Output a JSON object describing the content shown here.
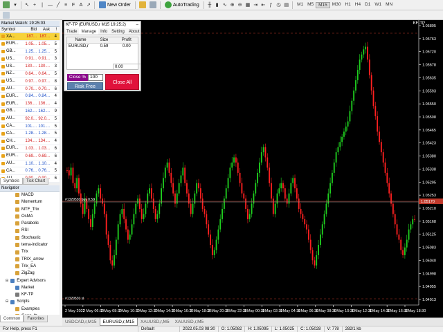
{
  "toolbar": {
    "new_order": "New Order",
    "auto_trading": "AutoTrading",
    "timeframes": [
      "M1",
      "M5",
      "M15",
      "M30",
      "H1",
      "H4",
      "D1",
      "W1",
      "MN"
    ],
    "active_timeframe": "M15"
  },
  "market_watch": {
    "title": "Market Watch: 19:25:03",
    "columns": [
      "Symbol",
      "Bid",
      "Ask",
      "!"
    ],
    "rows": [
      {
        "sym": "XA...",
        "bid": "187...",
        "ask": "187...",
        "sp": "4",
        "dir": "dn",
        "sel": true
      },
      {
        "sym": "EUR...",
        "bid": "1.05...",
        "ask": "1.05...",
        "sp": "5",
        "dir": "dn"
      },
      {
        "sym": "GB...",
        "bid": "1.25...",
        "ask": "1.25...",
        "sp": "5",
        "dir": "up"
      },
      {
        "sym": "US...",
        "bid": "0.91...",
        "ask": "0.91...",
        "sp": "3",
        "dir": "dn"
      },
      {
        "sym": "US...",
        "bid": "130....",
        "ask": "130....",
        "sp": "3",
        "dir": "dn"
      },
      {
        "sym": "NZ...",
        "bid": "0.64...",
        "ask": "0.64...",
        "sp": "5",
        "dir": "dn"
      },
      {
        "sym": "US...",
        "bid": "0.97...",
        "ask": "0.97...",
        "sp": "8",
        "dir": "dn"
      },
      {
        "sym": "AU...",
        "bid": "0.70...",
        "ask": "0.70...",
        "sp": "6",
        "dir": "dn"
      },
      {
        "sym": "EUR...",
        "bid": "0.84...",
        "ask": "0.84...",
        "sp": "4",
        "dir": "up"
      },
      {
        "sym": "EUR...",
        "bid": "136....",
        "ask": "136....",
        "sp": "4",
        "dir": "dn"
      },
      {
        "sym": "GB...",
        "bid": "162....",
        "ask": "162....",
        "sp": "9",
        "dir": "up"
      },
      {
        "sym": "AU...",
        "bid": "92.0...",
        "ask": "92.0...",
        "sp": "5",
        "dir": "dn"
      },
      {
        "sym": "CA...",
        "bid": "101....",
        "ask": "101....",
        "sp": "5",
        "dir": "up"
      },
      {
        "sym": "CA...",
        "bid": "1.28...",
        "ask": "1.28...",
        "sp": "5",
        "dir": "up"
      },
      {
        "sym": "CH...",
        "bid": "134....",
        "ask": "134....",
        "sp": "4",
        "dir": "dn"
      },
      {
        "sym": "EUR...",
        "bid": "1.03...",
        "ask": "1.03...",
        "sp": "6",
        "dir": "dn"
      },
      {
        "sym": "EUR...",
        "bid": "0.69...",
        "ask": "0.69...",
        "sp": "6",
        "dir": "dn"
      },
      {
        "sym": "AU...",
        "bid": "1.10...",
        "ask": "1.10...",
        "sp": "4",
        "dir": "up"
      },
      {
        "sym": "CA...",
        "bid": "0.76...",
        "ask": "0.76...",
        "sp": "5",
        "dir": "up"
      },
      {
        "sym": "AU...",
        "bid": "0.90...",
        "ask": "0.90...",
        "sp": "6",
        "dir": "dn"
      }
    ],
    "tabs": [
      "Symbols",
      "Tick Chart"
    ]
  },
  "navigator": {
    "title": "Navigator",
    "items": [
      {
        "label": "MACD",
        "indent": 2,
        "color": "#d8a23a"
      },
      {
        "label": "Momentum",
        "indent": 2,
        "color": "#d8a23a"
      },
      {
        "label": "MTF_Trix",
        "indent": 2,
        "color": "#d8a23a"
      },
      {
        "label": "OsMA",
        "indent": 2,
        "color": "#d8a23a"
      },
      {
        "label": "Parabolic",
        "indent": 2,
        "color": "#d8a23a"
      },
      {
        "label": "RSI",
        "indent": 2,
        "color": "#d8a23a"
      },
      {
        "label": "Stochastic",
        "indent": 2,
        "color": "#d8a23a"
      },
      {
        "label": "tema-indicator",
        "indent": 2,
        "color": "#d8a23a"
      },
      {
        "label": "Trix",
        "indent": 2,
        "color": "#d8a23a"
      },
      {
        "label": "TRIX_arrow",
        "indent": 2,
        "color": "#d8a23a"
      },
      {
        "label": "Trix_EA",
        "indent": 2,
        "color": "#d8a23a"
      },
      {
        "label": "ZigZag",
        "indent": 2,
        "color": "#d8a23a"
      },
      {
        "label": "Expert Advisors",
        "indent": 1,
        "color": "#4a7fc0"
      },
      {
        "label": "Market",
        "indent": 2,
        "color": "#4a7fc0"
      },
      {
        "label": "KF-TP",
        "indent": 2,
        "color": "#7a7a7a"
      },
      {
        "label": "Scripts",
        "indent": 1,
        "color": "#4a7fc0"
      },
      {
        "label": "Examples",
        "indent": 2,
        "color": "#d8a23a"
      },
      {
        "label": "Gann_fz",
        "indent": 2,
        "color": "#d8a23a"
      },
      {
        "label": "PeriodConverter",
        "indent": 2,
        "color": "#d8a23a"
      }
    ],
    "tabs": [
      "Common",
      "Favorites"
    ]
  },
  "chart": {
    "label": "KF-TP",
    "price_labels": [
      "1.05805",
      "1.05763",
      "1.05720",
      "1.05678",
      "1.05635",
      "1.05593",
      "1.05550",
      "1.05508",
      "1.05465",
      "1.05423",
      "1.05380",
      "1.05338",
      "1.05295",
      "1.05253",
      "1.05210",
      "1.05168",
      "1.05125",
      "1.05083",
      "1.05040",
      "1.04998",
      "1.04955",
      "1.04913"
    ],
    "current_price": "1.05170",
    "time_labels": [
      "2 May 2022",
      "2 May 06:30",
      "2 May 08:30",
      "2 May 10:30",
      "2 May 12:30",
      "2 May 14:30",
      "2 May 16:30",
      "2 May 18:30",
      "2 May 20:30",
      "2 May 22:30",
      "3 May 00:30",
      "3 May 02:30",
      "3 May 04:30",
      "3 May 06:30",
      "3 May 08:30",
      "3 May 10:30",
      "3 May 12:30",
      "3 May 14:30",
      "3 May 16:30",
      "3 May 18:30"
    ],
    "order_line_label": "#1329530 buy 0.59",
    "order_ticket_label": "#1329530 sl"
  },
  "chart_tabs": [
    {
      "label": "USDCAD,r,M15",
      "active": false
    },
    {
      "label": "EURUSD,r,M15",
      "active": true
    },
    {
      "label": "XAUUSD,r,M5",
      "active": false
    },
    {
      "label": "XAUUSD,r,M5",
      "active": false
    }
  ],
  "panel": {
    "title": "KF-TP (EURUSD,r  M15  19:25:2)",
    "tabs": [
      "Trade",
      "Manage",
      "Info",
      "Setting",
      "About"
    ],
    "active_tab": "Manage",
    "columns": [
      "Name",
      "Size",
      "Profit"
    ],
    "row": {
      "name": "EURUSD,r",
      "size": "0.59",
      "profit": "0.00"
    },
    "total": "0.00",
    "close_pct_label": "Close %",
    "close_pct_value": "100",
    "risk_free_label": "Risk Free",
    "close_all_label": "Close All"
  },
  "status": {
    "help": "For Help, press F1",
    "profile": "Default",
    "time": "2022.05.03 08:30",
    "open": "O: 1.05082",
    "high": "H: 1.05095",
    "low": "L: 1.05025",
    "close": "C: 1.05028",
    "volume": "V: 778",
    "traffic": "282/1 kb"
  }
}
